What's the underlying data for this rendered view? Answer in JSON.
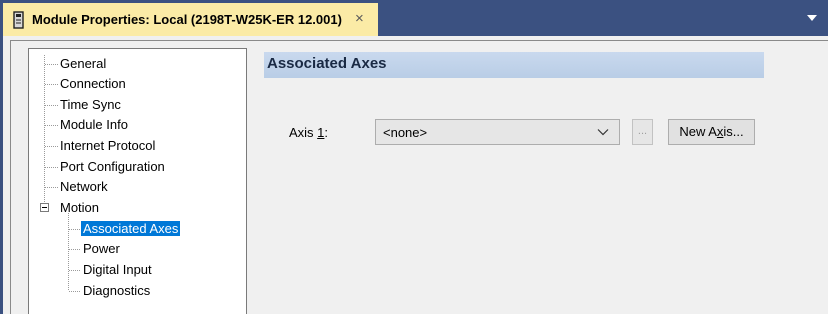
{
  "tab": {
    "title": "Module Properties: Local (2198T-W25K-ER 12.001)",
    "close": "×",
    "icon": "module-icon"
  },
  "tree": {
    "items": [
      {
        "label": "General"
      },
      {
        "label": "Connection"
      },
      {
        "label": "Time Sync"
      },
      {
        "label": "Module Info"
      },
      {
        "label": "Internet Protocol"
      },
      {
        "label": "Port Configuration"
      },
      {
        "label": "Network"
      },
      {
        "label": "Motion",
        "expanded": true
      },
      {
        "label": "Associated Axes",
        "selected": true
      },
      {
        "label": "Power"
      },
      {
        "label": "Digital Input"
      },
      {
        "label": "Diagnostics"
      }
    ]
  },
  "content": {
    "section_title": "Associated Axes",
    "axis_label_prefix": "Axis ",
    "axis_label_mnemonic": "1",
    "axis_label_suffix": ":",
    "axis_value": "<none>",
    "ellipsis_label": "...",
    "new_axis_prefix": "New A",
    "new_axis_mnemonic": "x",
    "new_axis_suffix": "is..."
  },
  "colors": {
    "tab_bar": "#3b5181",
    "active_tab": "#fbeba6",
    "selection": "#0078d7",
    "section_header": "#c9d9ee"
  }
}
